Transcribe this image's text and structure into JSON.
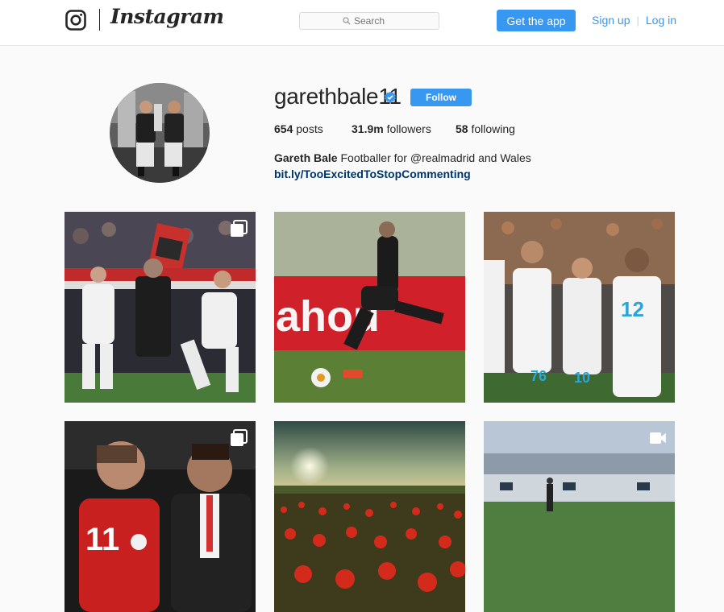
{
  "header": {
    "wordmark": "Instagram",
    "search_placeholder": "Search",
    "get_app": "Get the app",
    "sign_up": "Sign up",
    "separator": "|",
    "log_in": "Log in"
  },
  "profile": {
    "username": "garethbale11",
    "follow_label": "Follow",
    "posts_count": "654",
    "posts_label": "posts",
    "followers_count": "31.9m",
    "followers_label": "followers",
    "following_count": "58",
    "following_label": "following",
    "full_name": "Gareth Bale",
    "bio_mid": "Footballer for",
    "mention": "@realmadrid",
    "bio_end": "and Wales",
    "link": "bit.ly/TooExcitedToStopCommenting"
  },
  "posts": [
    {
      "type": "carousel"
    },
    {
      "type": "photo"
    },
    {
      "type": "photo"
    },
    {
      "type": "carousel"
    },
    {
      "type": "photo"
    },
    {
      "type": "video"
    }
  ],
  "colors": {
    "accent": "#3897f0",
    "link_dark": "#003569",
    "text": "#262626"
  }
}
